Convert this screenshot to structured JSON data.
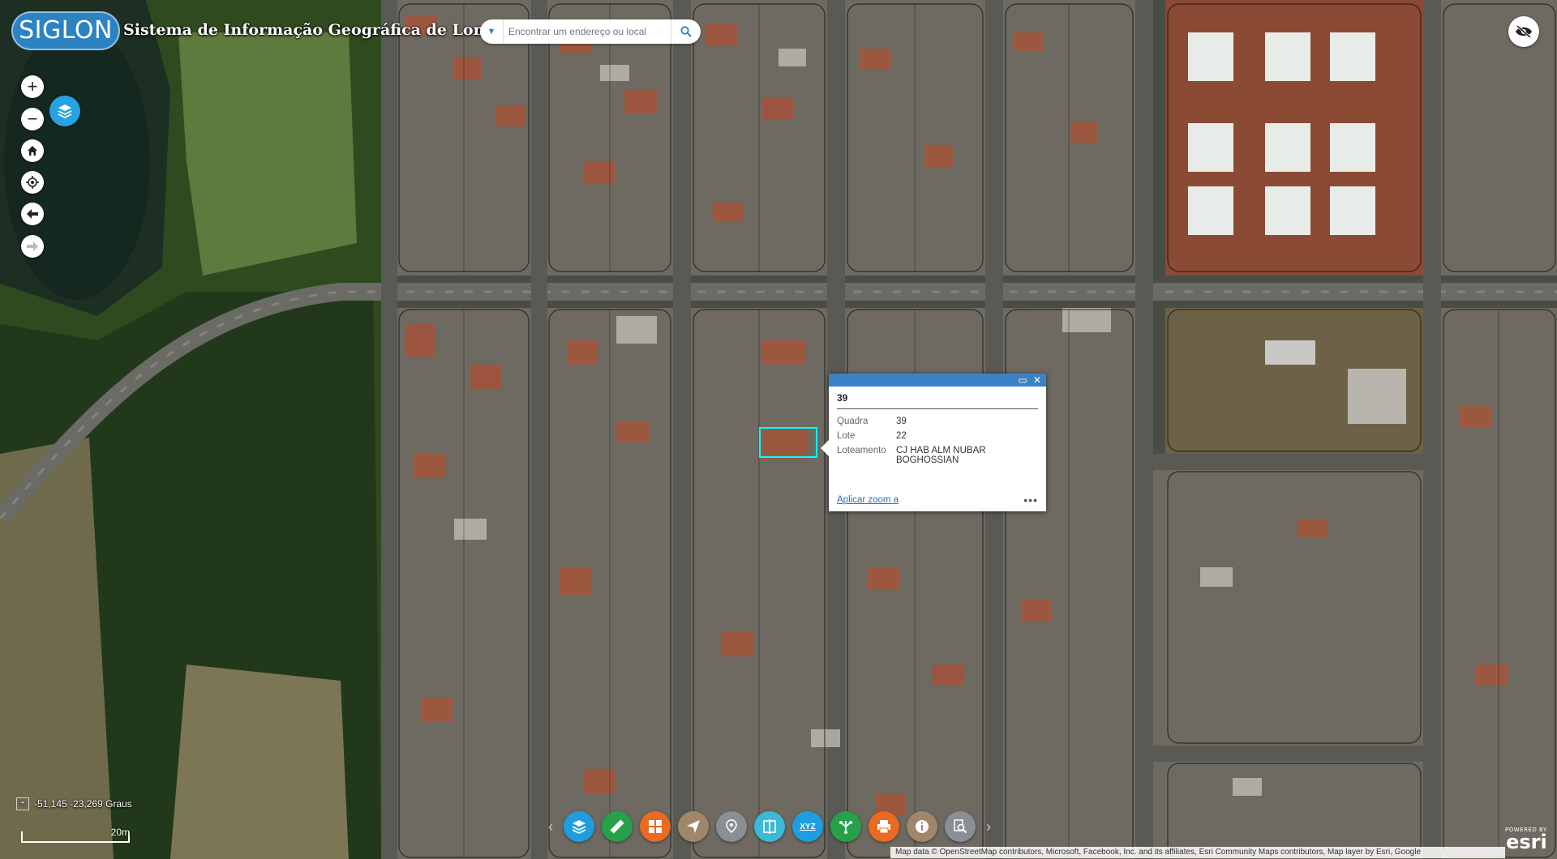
{
  "app": {
    "logo_text": "SIGLON",
    "title": "Sistema de Informação Geográfica de Londrina"
  },
  "search": {
    "placeholder": "Encontrar um endereço ou local",
    "icon": "search-icon"
  },
  "map_controls": {
    "zoom_in": "+",
    "zoom_out": "−",
    "icons": [
      "plus-icon",
      "minus-icon",
      "layers-icon",
      "home-icon",
      "locate-icon",
      "back-arrow-icon",
      "forward-arrow-icon",
      "eye-slash-icon"
    ]
  },
  "popup": {
    "title": "39",
    "fields": [
      {
        "key": "Quadra",
        "value": "39"
      },
      {
        "key": "Lote",
        "value": "22"
      },
      {
        "key": "Loteamento",
        "value": "CJ HAB ALM NUBAR BOGHOSSIAN"
      }
    ],
    "zoom_link": "Aplicar zoom a",
    "more": "•••"
  },
  "coordinates": "-51,145 -23,269 Graus",
  "scale_label": "20m",
  "toolbar": {
    "tools": [
      {
        "name": "layers-tool",
        "color": "#1e9ee0"
      },
      {
        "name": "measure-tool",
        "color": "#27a04a"
      },
      {
        "name": "basemap-gallery-tool",
        "color": "#e96a22"
      },
      {
        "name": "filter-tool",
        "color": "#a0876a"
      },
      {
        "name": "location-tool",
        "color": "#8a8f95"
      },
      {
        "name": "swipe-tool",
        "color": "#3db8d6"
      },
      {
        "name": "xyz-tool",
        "color": "#1e9ee0"
      },
      {
        "name": "share-tool",
        "color": "#27a04a"
      },
      {
        "name": "print-tool",
        "color": "#e96a22"
      },
      {
        "name": "info-tool",
        "color": "#a0876a"
      },
      {
        "name": "query-tool",
        "color": "#8a8f95"
      }
    ],
    "xyz_label": "XYZ"
  },
  "attribution": "Map data © OpenStreetMap contributors, Microsoft, Facebook, Inc. and its affiliates, Esri Community Maps contributors, Map layer by Esri, Google",
  "esri": {
    "powered_by": "POWERED BY",
    "brand": "esri"
  }
}
